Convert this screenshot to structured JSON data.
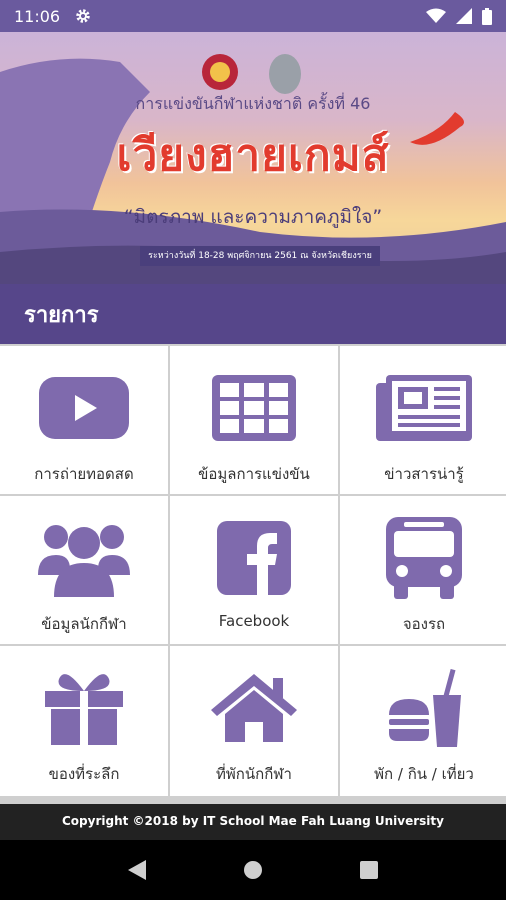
{
  "status_bar": {
    "time": "11:06"
  },
  "banner": {
    "subtitle": "การแข่งขันกีฬาแห่งชาติ ครั้งที่ 46",
    "title": "เวียงฮายเกมส์",
    "slogan": "“มิตรภาพ และความภาคภูมิใจ”",
    "dateline": "ระหว่างวันที่ 18-28 พฤศจิกายน 2561 ณ จังหวัดเชียงราย"
  },
  "section": {
    "title": "รายการ"
  },
  "menu": [
    {
      "label": "การถ่ายทอดสด",
      "icon": "youtube-icon"
    },
    {
      "label": "ข้อมูลการแข่งขัน",
      "icon": "table-icon"
    },
    {
      "label": "ข่าวสารน่ารู้",
      "icon": "newspaper-icon"
    },
    {
      "label": "ข้อมูลนักกีฬา",
      "icon": "group-icon"
    },
    {
      "label": "Facebook",
      "icon": "facebook-icon"
    },
    {
      "label": "จองรถ",
      "icon": "bus-icon"
    },
    {
      "label": "ของที่ระลึก",
      "icon": "gift-icon"
    },
    {
      "label": "ที่พักนักกีฬา",
      "icon": "home-icon"
    },
    {
      "label": "พัก / กิน / เที่ยว",
      "icon": "food-icon"
    }
  ],
  "footer": {
    "text": "Copyright ©2018 by IT School Mae Fah Luang University"
  },
  "colors": {
    "primary": "#56468a",
    "icon": "#7f6aad",
    "status": "#6a5a9e"
  }
}
